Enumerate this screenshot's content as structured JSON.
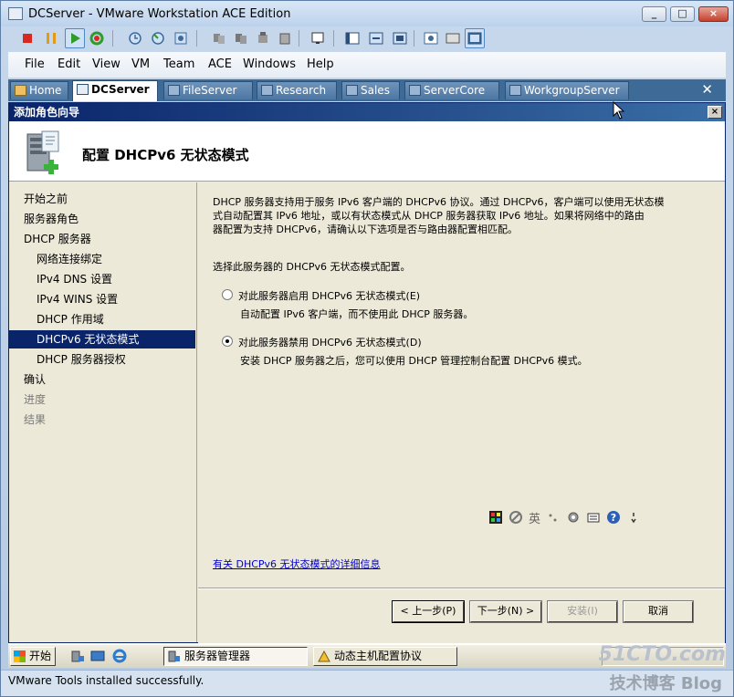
{
  "window": {
    "title": "DCServer - VMware Workstation ACE Edition",
    "controls": [
      "_",
      "□",
      "×"
    ]
  },
  "menubar": {
    "items": [
      "File",
      "Edit",
      "View",
      "VM",
      "Team",
      "ACE",
      "Windows",
      "Help"
    ]
  },
  "tabs": {
    "items": [
      {
        "label": "Home"
      },
      {
        "label": "DCServer"
      },
      {
        "label": "FileServer"
      },
      {
        "label": "Research"
      },
      {
        "label": "Sales"
      },
      {
        "label": "ServerCore"
      },
      {
        "label": "WorkgroupServer"
      }
    ],
    "active": "DCServer",
    "close_glyph": "✕"
  },
  "wizard": {
    "title": "添加角色向导",
    "close_glyph": "×",
    "heading": "配置 DHCPv6 无状态模式",
    "nav": [
      {
        "label": "开始之前"
      },
      {
        "label": "服务器角色"
      },
      {
        "label": "DHCP 服务器"
      },
      {
        "label": "网络连接绑定"
      },
      {
        "label": "IPv4 DNS 设置"
      },
      {
        "label": "IPv4 WINS 设置"
      },
      {
        "label": "DHCP 作用域"
      },
      {
        "label": "DHCPv6 无状态模式"
      },
      {
        "label": "DHCP 服务器授权"
      },
      {
        "label": "确认"
      },
      {
        "label": "进度"
      },
      {
        "label": "结果"
      }
    ],
    "selected_nav": "DHCPv6 无状态模式",
    "description_lines": [
      "DHCP 服务器支持用于服务 IPv6 客户端的 DHCPv6 协议。通过 DHCPv6，客户端可以使用无状态模",
      "式自动配置其 IPv6 地址，或以有状态模式从 DHCP 服务器获取 IPv6 地址。如果将网络中的路由",
      "器配置为支持 DHCPv6，请确认以下选项是否与路由器配置相匹配。"
    ],
    "prompt": "选择此服务器的 DHCPv6 无状态模式配置。",
    "options": [
      {
        "label": "对此服务器启用 DHCPv6 无状态模式(E)",
        "sub": "自动配置 IPv6 客户端，而不使用此 DHCP 服务器。",
        "checked": false
      },
      {
        "label": "对此服务器禁用 DHCPv6 无状态模式(D)",
        "sub": "安装 DHCP 服务器之后，您可以使用 DHCP 管理控制台配置 DHCPv6 模式。",
        "checked": true
      }
    ],
    "link": "有关 DHCPv6 无状态模式的详细信息",
    "langbar": {
      "ime": "英",
      "help": "?"
    },
    "buttons": {
      "prev": "< 上一步(P)",
      "next": "下一步(N) >",
      "install": "安装(I)",
      "cancel": "取消"
    }
  },
  "taskbar": {
    "start": "开始",
    "tasks": [
      {
        "label": "服务器管理器"
      },
      {
        "label": "动态主机配置协议"
      }
    ]
  },
  "status": {
    "text": "VMware Tools installed successfully."
  },
  "watermark": {
    "site": "51CTO.com",
    "caption": "技术博客 Blog"
  }
}
